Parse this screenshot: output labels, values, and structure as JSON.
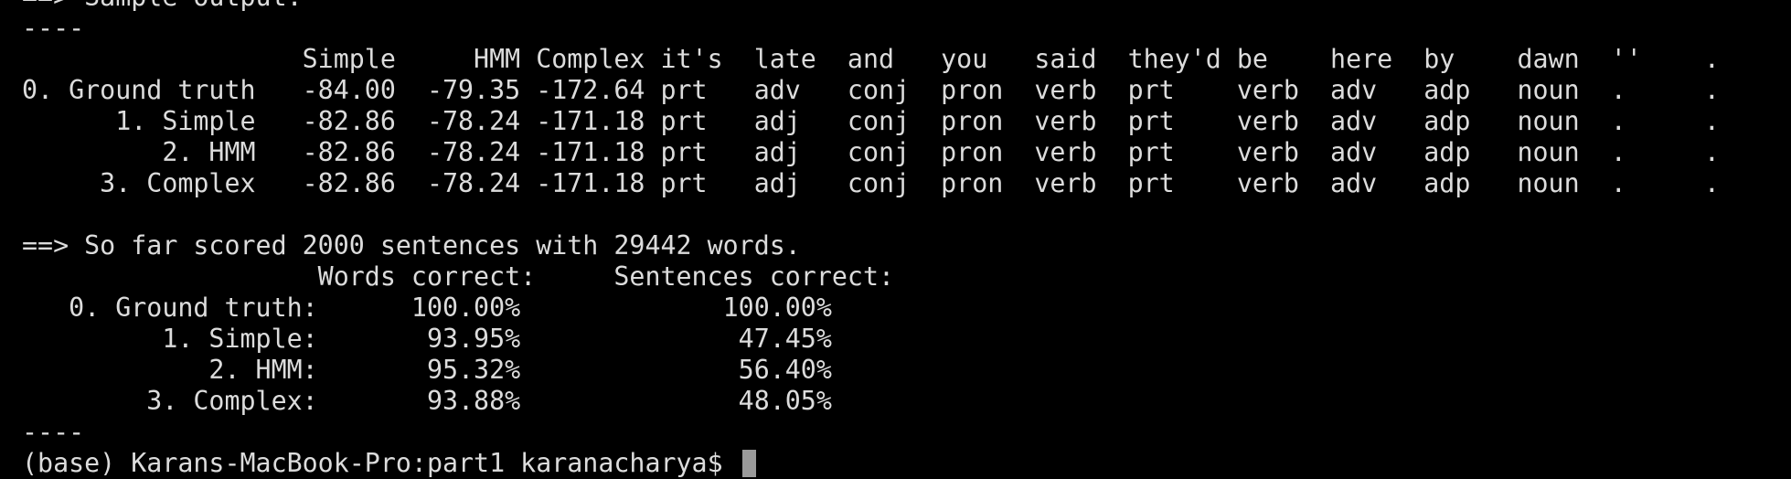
{
  "terminal": {
    "lines": [
      "==> Sample output:",
      "----",
      "                  Simple     HMM Complex it's  late  and   you   said  they'd be    here  by    dawn  ''    .",
      "0. Ground truth   -84.00  -79.35 -172.64 prt   adv   conj  pron  verb  prt    verb  adv   adp   noun  .     .",
      "      1. Simple   -82.86  -78.24 -171.18 prt   adj   conj  pron  verb  prt    verb  adv   adp   noun  .     .",
      "         2. HMM   -82.86  -78.24 -171.18 prt   adj   conj  pron  verb  prt    verb  adv   adp   noun  .     .",
      "     3. Complex   -82.86  -78.24 -171.18 prt   adj   conj  pron  verb  prt    verb  adv   adp   noun  .     .",
      "",
      "==> So far scored 2000 sentences with 29442 words.",
      "                   Words correct:     Sentences correct:",
      "   0. Ground truth:      100.00%             100.00%",
      "         1. Simple:       93.95%              47.45%",
      "            2. HMM:       95.32%              56.40%",
      "        3. Complex:       93.88%              48.05%",
      "----"
    ],
    "prompt": "(base) Karans-MacBook-Pro:part1 karanacharya$ "
  }
}
